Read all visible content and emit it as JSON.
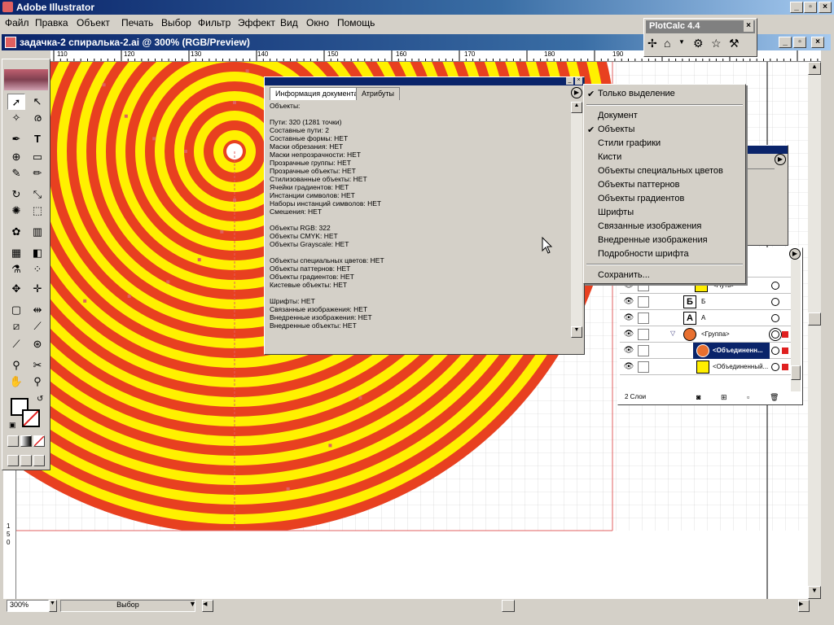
{
  "app": {
    "title": "Adobe Illustrator",
    "window_controls": [
      "_",
      "▫",
      "×"
    ]
  },
  "menu": [
    "Файл",
    "Правка",
    "Объект",
    "Печать",
    "Выбор",
    "Фильтр",
    "Эффект",
    "Вид",
    "Окно",
    "Помощь"
  ],
  "document": {
    "title": "задачка-2 спиралька-2.ai @ 300% (RGB/Preview)",
    "ruler_h": [
      "110",
      "120",
      "130",
      "140",
      "150",
      "160",
      "170",
      "180",
      "190"
    ],
    "ruler_v": [
      "1",
      "5",
      "0"
    ]
  },
  "status": {
    "zoom": "300%",
    "mode": "Выбор"
  },
  "plotcalc": {
    "title": "PlotCalc 4.4"
  },
  "info_panel": {
    "tabs": [
      "Информация документа",
      "Атрибуты"
    ],
    "text": "Объекты:\n\nПути: 320 (1281 точки)\nСоставные пути: 2\nСоставные формы: НЕТ\nМаски обрезания: НЕТ\nМаски непрозрачности: НЕТ\nПрозрачные группы: НЕТ\nПрозрачные объекты: НЕТ\nСтилизованные объекты: НЕТ\nЯчейки градиентов: НЕТ\nИнстанции символов: НЕТ\nНаборы инстанций символов: НЕТ\nСмешения: НЕТ\n\nОбъекты RGB: 322\nОбъекты CMYK: НЕТ\nОбъекты Grayscale: НЕТ\n\nОбъекты специальных цветов: НЕТ\nОбъекты паттернов: НЕТ\nОбъекты градиентов: НЕТ\nКистевые объекты: НЕТ\n\nШрифты: НЕТ\nСвязанные изображения: НЕТ\nВнедренные изображения: НЕТ\nВнедренные объекты: НЕТ"
  },
  "dropdown": {
    "items": [
      {
        "label": "Только выделение",
        "checked": true
      },
      {
        "label": "Документ",
        "checked": false
      },
      {
        "label": "Объекты",
        "checked": true
      },
      {
        "label": "Стили графики",
        "checked": false
      },
      {
        "label": "Кисти",
        "checked": false
      },
      {
        "label": "Объекты специальных цветов",
        "checked": false
      },
      {
        "label": "Объекты паттернов",
        "checked": false
      },
      {
        "label": "Объекты градиентов",
        "checked": false
      },
      {
        "label": "Шрифты",
        "checked": false
      },
      {
        "label": "Связанные изображения",
        "checked": false
      },
      {
        "label": "Внедренные изображения",
        "checked": false
      },
      {
        "label": "Подробности шрифта",
        "checked": false
      },
      {
        "label": "Сохранить...",
        "checked": false
      }
    ],
    "check_mark": "✔"
  },
  "layers": {
    "rows": [
      {
        "name": "<Путь>",
        "thumb": "#ffee00"
      },
      {
        "name": "Б",
        "thumb": "letter"
      },
      {
        "name": "А",
        "thumb": "letter"
      },
      {
        "name": "<Группа>",
        "thumb": "#e87030"
      },
      {
        "name": "<Объединенн...",
        "thumb": "#e87030",
        "selected": true
      },
      {
        "name": "<Объединенный...",
        "thumb": "#ffee00"
      }
    ],
    "footer": "2 Слои",
    "eye": "👁"
  },
  "colors": {
    "stripe_red": "#e84020",
    "stripe_yellow": "#fff000",
    "title_blue": "#0a246a",
    "selection": "#0a246a",
    "guide_red": "#e06060"
  }
}
